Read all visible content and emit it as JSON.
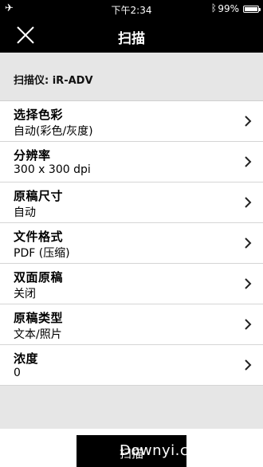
{
  "status": {
    "time": "下午2:34",
    "battery": "99%",
    "battery_level": 0.99
  },
  "nav": {
    "title": "扫描"
  },
  "scanner": {
    "label": "扫描仪: iR-ADV"
  },
  "settings": [
    {
      "label": "选择色彩",
      "value": "自动(彩色/灰度)"
    },
    {
      "label": "分辨率",
      "value": "300 x 300 dpi"
    },
    {
      "label": "原稿尺寸",
      "value": "自动"
    },
    {
      "label": "文件格式",
      "value": "PDF (压缩)"
    },
    {
      "label": "双面原稿",
      "value": "关闭"
    },
    {
      "label": "原稿类型",
      "value": "文本/照片"
    },
    {
      "label": "浓度",
      "value": "0"
    }
  ],
  "scan_button": {
    "label": "扫描"
  },
  "watermark": {
    "text": "Downyi.com"
  }
}
